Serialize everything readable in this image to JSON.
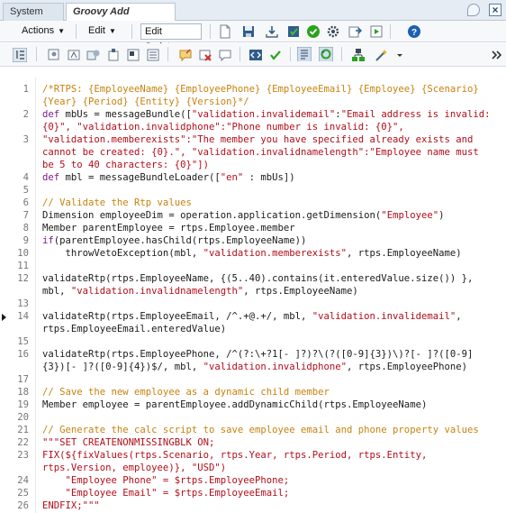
{
  "tabs": [
    {
      "label": "System View",
      "active": false
    },
    {
      "label": "Groovy Add Employee",
      "active": true
    }
  ],
  "toolbar": {
    "actions_label": "Actions",
    "edit_label": "Edit",
    "edit_script_label": "Edit Script"
  },
  "colors": {
    "comment": "#c8820e",
    "keyword": "#7a1a8c",
    "string": "#b20e1a",
    "accent": "#1d4b80"
  },
  "editor": {
    "lines": [
      {
        "num": "1",
        "text": "/*RTPS: {EmployeeName} {EmployeePhone} {EmployeeEmail} {Employee} {Scenario}",
        "style": "cm"
      },
      {
        "num": "",
        "text": "{Year} {Period} {Entity} {Version}*/",
        "style": "cm"
      },
      {
        "num": "2",
        "text": "def mbUs = messageBundle([\"validation.invalidemail\":\"Email address is invalid:",
        "style": "mix2"
      },
      {
        "num": "",
        "text": "{0}\", \"validation.invalidphone\":\"Phone number is invalid: {0}\",",
        "style": "st"
      },
      {
        "num": "3",
        "text": "\"validation.memberexists\":\"The member you have specified already exists and",
        "style": "st"
      },
      {
        "num": "",
        "text": "cannot be created: {0}.\", \"validation.invalidnamelength\":\"Employee name must",
        "style": "st"
      },
      {
        "num": "",
        "text": "be 5 to 40 characters: {0}\"])",
        "style": "st"
      },
      {
        "num": "4",
        "text": "def mbl = messageBundleLoader([\"en\" : mbUs])",
        "style": "mix4"
      },
      {
        "num": "5",
        "text": "",
        "style": "pl"
      },
      {
        "num": "6",
        "text": "// Validate the Rtp values",
        "style": "cm"
      },
      {
        "num": "7",
        "text": "Dimension employeeDim = operation.application.getDimension(\"Employee\")",
        "style": "mix7"
      },
      {
        "num": "8",
        "text": "Member parentEmployee = rtps.Employee.member",
        "style": "pl"
      },
      {
        "num": "9",
        "text": "if(parentEmployee.hasChild(rtps.EmployeeName))",
        "style": "mix9"
      },
      {
        "num": "10",
        "text": "    throwVetoException(mbl, \"validation.memberexists\", rtps.EmployeeName)",
        "style": "mix10"
      },
      {
        "num": "11",
        "text": "",
        "style": "pl"
      },
      {
        "num": "12",
        "text": "validateRtp(rtps.EmployeeName, {(5..40).contains(it.enteredValue.size()) },",
        "style": "mix12"
      },
      {
        "num": "",
        "text": "mbl, \"validation.invalidnamelength\", rtps.EmployeeName)",
        "style": "mix12b"
      },
      {
        "num": "13",
        "text": "",
        "style": "pl"
      },
      {
        "num": "14",
        "text": "validateRtp(rtps.EmployeeEmail, /^.+@.+/, mbl, \"validation.invalidemail\",",
        "style": "mix14"
      },
      {
        "num": "",
        "text": "rtps.EmployeeEmail.enteredValue)",
        "style": "pl"
      },
      {
        "num": "15",
        "text": "",
        "style": "pl"
      },
      {
        "num": "16",
        "text": "validateRtp(rtps.EmployeePhone, /^(?:\\+?1[- ]?)?\\(?([0-9]{3})\\)?[- ]?([0-9]",
        "style": "mix16"
      },
      {
        "num": "",
        "text": "{3})[- ]?([0-9]{4})$/, mbl, \"validation.invalidphone\", rtps.EmployeePhone)",
        "style": "mix16b"
      },
      {
        "num": "17",
        "text": "",
        "style": "pl"
      },
      {
        "num": "18",
        "text": "// Save the new employee as a dynamic child member",
        "style": "cm"
      },
      {
        "num": "19",
        "text": "Member employee = parentEmployee.addDynamicChild(rtps.EmployeeName)",
        "style": "pl"
      },
      {
        "num": "20",
        "text": "",
        "style": "pl"
      },
      {
        "num": "21",
        "text": "// Generate the calc script to save employee email and phone property values",
        "style": "cm"
      },
      {
        "num": "22",
        "text": "\"\"\"SET CREATENONMISSINGBLK ON;",
        "style": "st"
      },
      {
        "num": "23",
        "text": "FIX(${fixValues(rtps.Scenario, rtps.Year, rtps.Period, rtps.Entity,",
        "style": "st"
      },
      {
        "num": "",
        "text": "rtps.Version, employee)}, \"USD\")",
        "style": "st"
      },
      {
        "num": "24",
        "text": "    \"Employee Phone\" = $rtps.EmployeePhone;",
        "style": "st"
      },
      {
        "num": "25",
        "text": "    \"Employee Email\" = $rtps.EmployeeEmail;",
        "style": "st"
      },
      {
        "num": "26",
        "text": "ENDFIX;\"\"\"",
        "style": "st"
      }
    ]
  }
}
